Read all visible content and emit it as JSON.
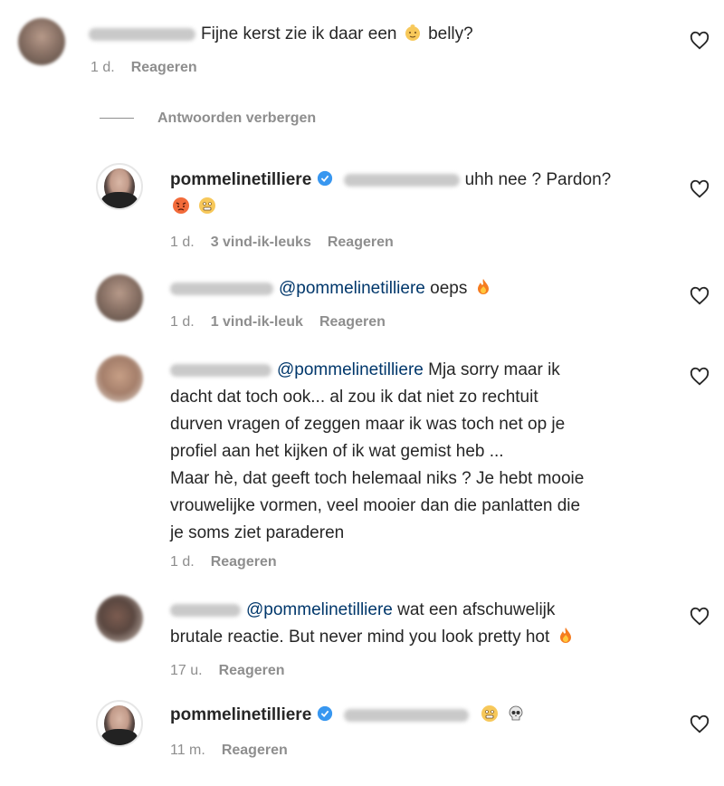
{
  "comments": [
    {
      "text": "Fijne kerst zie ik daar een",
      "text_after": "belly?",
      "emoji": "baby-face",
      "time": "1 d.",
      "reply": "Reageren"
    },
    {
      "hide_replies": "Antwoorden verbergen"
    },
    {
      "username": "pommelinetilliere",
      "text": "uhh nee ? Pardon?",
      "time": "1 d.",
      "likes": "3 vind-ik-leuks",
      "reply": "Reageren"
    },
    {
      "mention": "@pommelinetilliere",
      "text": "oeps",
      "time": "1 d.",
      "likes": "1 vind-ik-leuk",
      "reply": "Reageren"
    },
    {
      "mention": "@pommelinetilliere",
      "lines": [
        "Mja sorry maar ik",
        "dacht dat toch ook... al zou ik dat niet zo rechtuit",
        "durven vragen of zeggen maar ik was toch net op je",
        "profiel aan het kijken of ik wat gemist heb ...",
        "Maar hè, dat geeft toch helemaal niks ? Je hebt mooie",
        "vrouwelijke vormen, veel mooier dan die panlatten die",
        "je soms ziet paraderen"
      ],
      "time": "1 d.",
      "reply": "Reageren"
    },
    {
      "mention": "@pommelinetilliere",
      "lines": [
        "wat een afschuwelijk",
        "brutale reactie. But never mind you look pretty hot"
      ],
      "time": "17 u.",
      "reply": "Reageren"
    },
    {
      "username": "pommelinetilliere",
      "time": "11 m.",
      "reply": "Reageren"
    }
  ],
  "icons": {
    "like": "heart-outline-icon",
    "verified": "verified-badge-icon"
  },
  "colors": {
    "mention": "#00376b",
    "meta": "#8e8e8e",
    "verified": "#3897f0"
  }
}
